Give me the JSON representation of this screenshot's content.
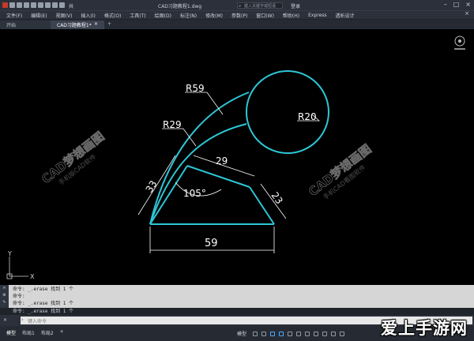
{
  "titlebar": {
    "share_label": "共享",
    "doc_title": "CAD习题教程1.dwg",
    "search_placeholder": "键入关键字或短语",
    "login_label": "登录"
  },
  "menu": [
    "文件(F)",
    "编辑(E)",
    "视图(V)",
    "插入(I)",
    "格式(O)",
    "工具(T)",
    "绘图(D)",
    "标注(N)",
    "修改(M)",
    "参数(P)",
    "窗口(W)",
    "帮助(H)",
    "Express",
    "透析设计"
  ],
  "tabs": {
    "start": "开始",
    "active": "CAD习题教程1*",
    "active_close": "×",
    "plus": "+"
  },
  "drawing": {
    "dimensions": {
      "r59": "R59",
      "r29": "R29",
      "r20": "R20",
      "d29": "29",
      "d33": "33",
      "d23": "23",
      "d59": "59",
      "angle": "105°"
    },
    "watermark_left": "CAD梦想画图",
    "watermark_left_sub": "手机版CAD软件",
    "watermark_right": "CAD梦想画图",
    "watermark_right_sub": "手机CAD看图软件",
    "axis_x": "X",
    "axis_y": "Y",
    "line_color": "#2ec6d6",
    "dim_color": "#ffffff"
  },
  "command": {
    "history": [
      "命令: _.erase 找到 1 个",
      "命令:",
      "命令: _.erase 找到 1 个",
      "命令:",
      "命令: _.erase 找到 1 个"
    ],
    "placeholder": "键入命令"
  },
  "statusbar": {
    "layouts": [
      "模型",
      "布局1",
      "布局2"
    ],
    "model_label": "模型"
  },
  "site_watermark": "爱上手游网"
}
